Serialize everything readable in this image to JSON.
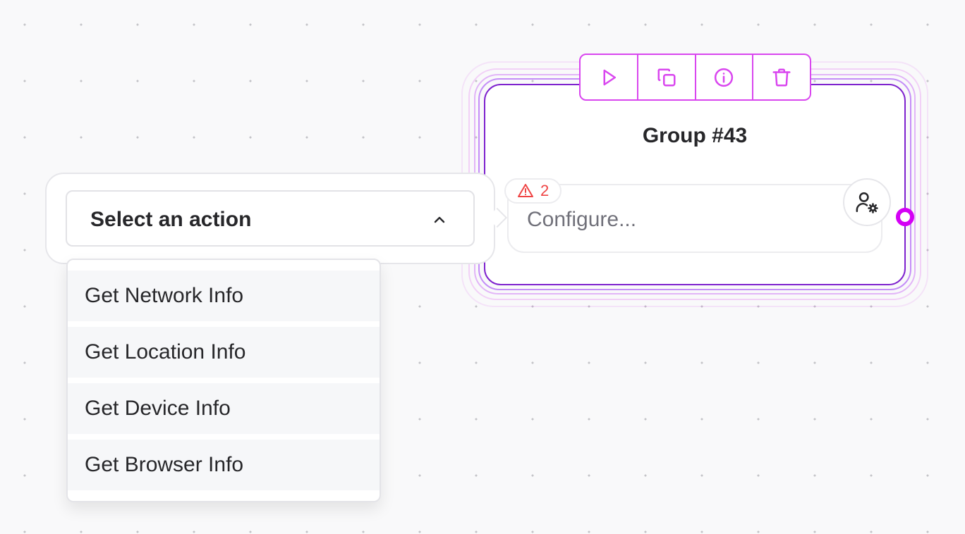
{
  "node": {
    "title": "Group #43",
    "warning_count": "2",
    "configure_placeholder": "Configure...",
    "accent_color": "#d946ef",
    "toolbar": {
      "icons": [
        "play-icon",
        "copy-icon",
        "info-icon",
        "trash-icon"
      ]
    }
  },
  "action_select": {
    "label": "Select an action",
    "options": [
      "Get Network Info",
      "Get Location Info",
      "Get Device Info",
      "Get Browser Info"
    ]
  }
}
